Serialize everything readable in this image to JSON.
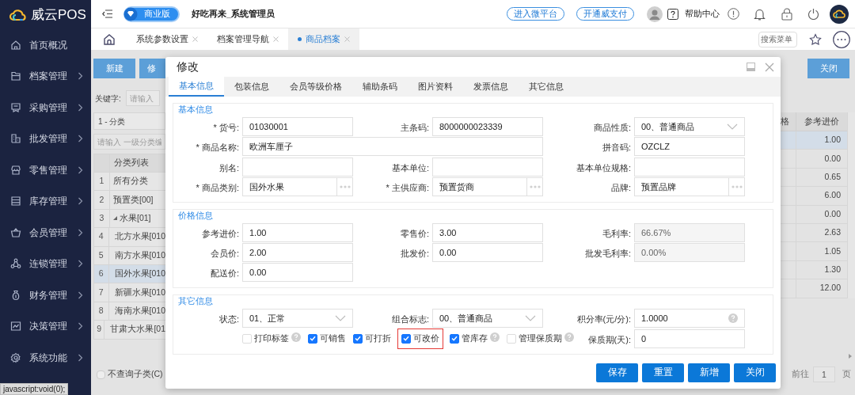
{
  "sidebar": {
    "brand": "威云POS",
    "items": [
      {
        "label": "首页概况",
        "submenu": false
      },
      {
        "label": "档案管理",
        "submenu": true
      },
      {
        "label": "采购管理",
        "submenu": true
      },
      {
        "label": "批发管理",
        "submenu": true
      },
      {
        "label": "零售管理",
        "submenu": true
      },
      {
        "label": "库存管理",
        "submenu": true
      },
      {
        "label": "会员管理",
        "submenu": true
      },
      {
        "label": "连锁管理",
        "submenu": true
      },
      {
        "label": "财务管理",
        "submenu": true
      },
      {
        "label": "决策管理",
        "submenu": true
      },
      {
        "label": "系统功能",
        "submenu": true
      }
    ]
  },
  "topbar": {
    "edition": "商业版",
    "user": "好吃再来_系统管理员",
    "links": [
      "进入微平台",
      "开通威支付"
    ],
    "help": "帮助中心"
  },
  "tabs": [
    {
      "label": "系统参数设置",
      "selected": false
    },
    {
      "label": "档案管理导航",
      "selected": false
    },
    {
      "label": "商品档案",
      "selected": true
    }
  ],
  "menu_search": {
    "placeholder": "搜索菜单"
  },
  "background": {
    "buttons": [
      "新建",
      "修"
    ],
    "keyword": {
      "label": "关键字:",
      "placeholder": "请输入"
    },
    "category_panel": {
      "title": "1 - 分类",
      "filter_placeholder": "请输入 一级分类编",
      "column": "分类列表",
      "rows": [
        {
          "index": "1",
          "name": "所有分类",
          "selected": false
        },
        {
          "index": "2",
          "name": "预置类[00]",
          "selected": false
        },
        {
          "index": "3",
          "name": "水果[01]",
          "selected": false,
          "expanded": true,
          "children": [
            {
              "index": "4",
              "name": "北方水果[010",
              "selected": false
            },
            {
              "index": "5",
              "name": "南方水果[010",
              "selected": false
            },
            {
              "index": "6",
              "name": "国外水果[010",
              "selected": true
            },
            {
              "index": "7",
              "name": "新疆水果[010",
              "selected": false
            },
            {
              "index": "8",
              "name": "海南水果[010",
              "selected": false
            },
            {
              "index": "9",
              "name": "甘肃大水果[01",
              "selected": false
            }
          ]
        }
      ]
    },
    "subcategory_option": {
      "label": "不查询子类(C)",
      "checked": false
    },
    "close_button": "关闭",
    "table": {
      "columns": [
        "格",
        "参考进价"
      ],
      "rows": [
        {
          "value": "1.00",
          "selected": true
        },
        {
          "value": "0.00",
          "selected": false
        },
        {
          "value": "0.65",
          "selected": false
        },
        {
          "value": "6.00",
          "selected": false
        },
        {
          "value": "0.00",
          "selected": false
        },
        {
          "value": "2.63",
          "selected": false
        },
        {
          "value": "1.05",
          "selected": false
        },
        {
          "value": "1.30",
          "selected": false
        },
        {
          "value": "12.00",
          "selected": false
        }
      ]
    },
    "pagination": {
      "goto": "前往",
      "page": "1",
      "unit": "页"
    }
  },
  "modal": {
    "title": "修改",
    "tabs": [
      {
        "label": "基本信息",
        "selected": true
      },
      {
        "label": "包装信息",
        "selected": false
      },
      {
        "label": "会员等级价格",
        "selected": false
      },
      {
        "label": "辅助条码",
        "selected": false
      },
      {
        "label": "图片资料",
        "selected": false
      },
      {
        "label": "发票信息",
        "selected": false
      },
      {
        "label": "其它信息",
        "selected": false
      }
    ],
    "sections": [
      {
        "title": "基本信息",
        "rows": [
          {
            "fields": [
              {
                "label": "* 货号:",
                "value": "01030001",
                "kind": "text"
              },
              {
                "label": "主条码:",
                "value": "8000000023339",
                "kind": "text"
              },
              {
                "label": "商品性质:",
                "value": "00、普通商品",
                "kind": "select"
              }
            ]
          },
          {
            "fields": [
              {
                "label": "* 商品名称:",
                "value": "欧洲车厘子",
                "kind": "wide"
              },
              {
                "label": "拼音码:",
                "value": "OZCLZ",
                "kind": "text"
              }
            ]
          },
          {
            "fields": [
              {
                "label": "别名:",
                "kind": "text"
              },
              {
                "label": "基本单位:",
                "kind": "text"
              },
              {
                "label": "基本单位规格:",
                "kind": "text"
              }
            ]
          },
          {
            "fields": [
              {
                "label": "* 商品类别:",
                "value": "国外水果",
                "kind": "lookup"
              },
              {
                "label": "* 主供应商:",
                "value": "预置货商",
                "kind": "lookup"
              },
              {
                "label": "品牌:",
                "value": "预置品牌",
                "kind": "lookup"
              }
            ]
          }
        ]
      },
      {
        "title": "价格信息",
        "rows": [
          {
            "fields": [
              {
                "label": "参考进价:",
                "value": "1.00",
                "kind": "text"
              },
              {
                "label": "零售价:",
                "value": "3.00",
                "kind": "text"
              },
              {
                "label": "毛利率:",
                "value": "66.67%",
                "kind": "readonly"
              }
            ]
          },
          {
            "fields": [
              {
                "label": "会员价:",
                "value": "2.00",
                "kind": "text"
              },
              {
                "label": "批发价:",
                "value": "0.00",
                "kind": "text"
              },
              {
                "label": "批发毛利率:",
                "value": "0.00%",
                "kind": "readonly"
              }
            ]
          },
          {
            "fields": [
              {
                "label": "配送价:",
                "value": "0.00",
                "kind": "text"
              }
            ]
          }
        ]
      },
      {
        "title": "其它信息",
        "rows": [
          {
            "fields": [
              {
                "label": "状态:",
                "value": "01、正常",
                "kind": "select"
              },
              {
                "label": "组合标志:",
                "value": "00、普通商品",
                "kind": "select"
              },
              {
                "label": "积分率(元/分):",
                "value": "1.0000",
                "kind": "help"
              }
            ]
          },
          {
            "fields": [
              {
                "kind": "options",
                "options": [
                  {
                    "label": "打印标签",
                    "checked": false,
                    "help": true,
                    "highlighted": false
                  },
                  {
                    "label": "可销售",
                    "checked": true,
                    "help": false,
                    "highlighted": false
                  },
                  {
                    "label": "可打折",
                    "checked": true,
                    "help": false,
                    "highlighted": false
                  },
                  {
                    "label": "可改价",
                    "checked": true,
                    "help": false,
                    "highlighted": true
                  },
                  {
                    "label": "管库存",
                    "checked": true,
                    "help": true,
                    "highlighted": false
                  },
                  {
                    "label": "管理保质期",
                    "checked": false,
                    "help": true,
                    "highlighted": false
                  }
                ]
              },
              {
                "label": "保质期(天):",
                "value": "0",
                "kind": "text"
              }
            ]
          }
        ]
      }
    ],
    "buttons": [
      "保存",
      "重置",
      "新增",
      "关闭"
    ]
  },
  "status_url": "javascript:void(0);"
}
